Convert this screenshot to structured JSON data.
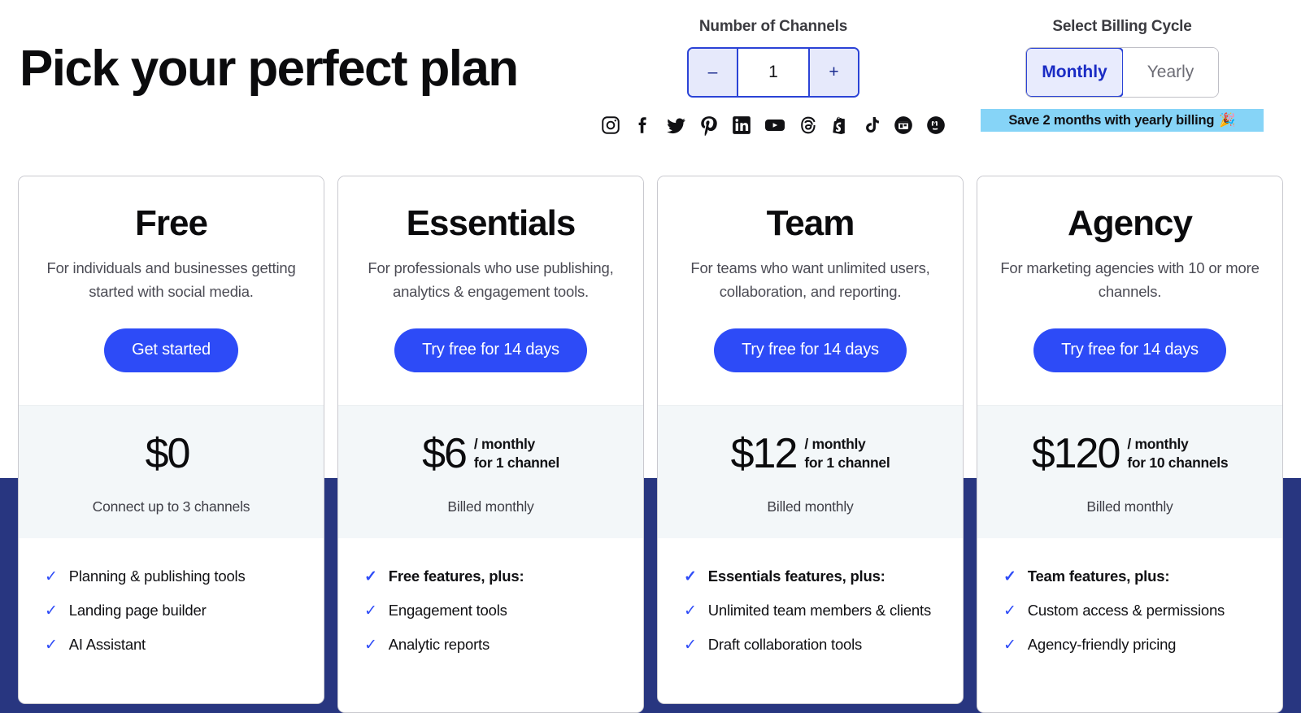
{
  "header": {
    "headline": "Pick your perfect plan",
    "channels": {
      "label": "Number of Channels",
      "decrement_label": "–",
      "increment_label": "+",
      "value": "1"
    },
    "billing": {
      "label": "Select Billing Cycle",
      "options": [
        "Monthly",
        "Yearly"
      ],
      "selected": "Monthly",
      "save_banner": "Save 2 months with yearly billing",
      "save_banner_emoji": "🎉"
    },
    "social_icons": [
      "instagram-icon",
      "facebook-icon",
      "twitter-icon",
      "pinterest-icon",
      "linkedin-icon",
      "youtube-icon",
      "threads-icon",
      "shopify-icon",
      "tiktok-icon",
      "google-business-icon",
      "mastodon-icon"
    ]
  },
  "colors": {
    "accent_blue": "#2d4bf7",
    "navy_band": "#283680",
    "banner_blue": "#86d4f7",
    "price_band": "#f3f7f9"
  },
  "plans": [
    {
      "name": "Free",
      "description": "For individuals and businesses getting started with social media.",
      "cta": "Get started",
      "price_amount": "$0",
      "price_unit_line1": "",
      "price_unit_line2": "",
      "price_sub": "Connect up to 3 channels",
      "features": [
        {
          "text": "Planning & publishing tools",
          "bold": false
        },
        {
          "text": "Landing page builder",
          "bold": false
        },
        {
          "text": "AI Assistant",
          "bold": false
        }
      ]
    },
    {
      "name": "Essentials",
      "description": "For professionals who use publishing, analytics & engagement tools.",
      "cta": "Try free for 14 days",
      "price_amount": "$6",
      "price_unit_line1": "/ monthly",
      "price_unit_line2": "for 1 channel",
      "price_sub": "Billed monthly",
      "features": [
        {
          "text": "Free features, plus:",
          "bold": true
        },
        {
          "text": "Engagement tools",
          "bold": false
        },
        {
          "text": "Analytic reports",
          "bold": false
        }
      ]
    },
    {
      "name": "Team",
      "description": "For teams who want unlimited users, collaboration, and reporting.",
      "cta": "Try free for 14 days",
      "price_amount": "$12",
      "price_unit_line1": "/ monthly",
      "price_unit_line2": "for 1 channel",
      "price_sub": "Billed monthly",
      "features": [
        {
          "text": "Essentials features, plus:",
          "bold": true
        },
        {
          "text": "Unlimited team members & clients",
          "bold": false
        },
        {
          "text": "Draft collaboration tools",
          "bold": false
        }
      ]
    },
    {
      "name": "Agency",
      "description": "For marketing agencies with 10 or more channels.",
      "cta": "Try free for 14 days",
      "price_amount": "$120",
      "price_unit_line1": "/ monthly",
      "price_unit_line2": "for 10 channels",
      "price_sub": "Billed monthly",
      "features": [
        {
          "text": "Team features, plus:",
          "bold": true
        },
        {
          "text": "Custom access & permissions",
          "bold": false
        },
        {
          "text": "Agency-friendly pricing",
          "bold": false
        }
      ]
    }
  ]
}
